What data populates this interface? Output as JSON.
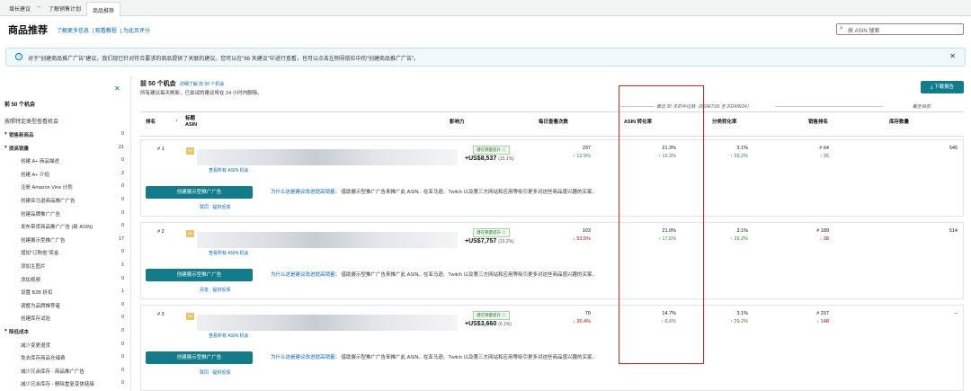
{
  "breadcrumbs": [
    "增长建议",
    "了解销售计划",
    "商品推荐"
  ],
  "page": {
    "title": "商品推荐",
    "links": [
      "了解更多信息",
      "观看教程",
      "为此页评分"
    ],
    "search_placeholder": "按 ASIN 搜索"
  },
  "banner": {
    "text": "对于\"创建商品推广广告\"建议，我们现已针对符合要求的商品提供了关联的建议。您可以在\"86 天建议\"中进行查看，也可以点击左侧导航栏中的\"创建商品推广广告\"。"
  },
  "sidebar": {
    "heading": "前 50 个机会",
    "subheading": "按照特定类型查看机会",
    "items": [
      {
        "label": "销售新商品",
        "count": "0",
        "cat": true
      },
      {
        "label": "提高销量",
        "count": "21",
        "cat": true
      },
      {
        "label": "创建 A+ 商品描述",
        "count": "0"
      },
      {
        "label": "创建 A+ 介绍",
        "count": "2"
      },
      {
        "label": "注册 Amazon Vine 计划",
        "count": "0"
      },
      {
        "label": "创建亚马逊商品推广广告",
        "count": "0"
      },
      {
        "label": "创建品牌推广广告",
        "count": "0"
      },
      {
        "label": "发布带货商品推广广告 (新 ASIN)",
        "count": "0"
      },
      {
        "label": "创建展示型推广广告",
        "count": "17"
      },
      {
        "label": "增加\"订购省\"资金",
        "count": "0"
      },
      {
        "label": "添加主图片",
        "count": "1"
      },
      {
        "label": "添加视频",
        "count": "0"
      },
      {
        "label": "设置 B2B 折扣",
        "count": "1"
      },
      {
        "label": "调整为品牌推荐者",
        "count": "0"
      },
      {
        "label": "创建库存试验",
        "count": "0"
      },
      {
        "label": "降低成本",
        "count": "0",
        "cat": true
      },
      {
        "label": "减少变更退货",
        "count": "0"
      },
      {
        "label": "免去库存商品仓储费",
        "count": "0"
      },
      {
        "label": "减少冗余库存 - 商品推广广告",
        "count": "0"
      },
      {
        "label": "减少冗余库存 - 删除重复变体链接",
        "count": "0"
      }
    ]
  },
  "main": {
    "heading": "前 50 个机会",
    "heading_link": "详细了解 前 50 个机会",
    "sub": "所有建议每天刷新，已尝试的建议将在 24 小时内删除。",
    "download": "下载报告",
    "group1": "最近 30 天的中位数（2024/7/26 至 2024/8/24）",
    "group2": "截至目前",
    "columns": [
      "排名",
      "标题\nASIN",
      "影响力",
      "每日查看次数",
      "ASIN 转化率",
      "分类转化率",
      "销售排名",
      "库存数量"
    ]
  },
  "rows": [
    {
      "rank": "# 1",
      "asin_link": "查看所有 ASIN 机会",
      "badge": "潜在销量提升 ⓘ",
      "impact": "+US$8,537",
      "impact_pct": "(15.1%)",
      "views": "237",
      "views_chg": "↑ 12.9%",
      "views_dir": "up",
      "conv": "21.3%",
      "conv_chg": "↑ 16.3%",
      "conv_dir": "up",
      "cat": "3.1%",
      "cat_chg": "↑ 29.2%",
      "cat_dir": "up",
      "sales_rank": "# 64",
      "sales_chg": "↑ 35",
      "sales_dir": "up",
      "stock": "545",
      "cta": "创建展示型推广广告",
      "why": "为什么这是建议改进提高销量：",
      "why_text": "借助展示型推广广告来推广此 ASIN。在亚马逊、Twitch 以及第三方网站和应用等吸引更多对这些商品感兴趣的买家。",
      "feedback": "赞同 · 提供反馈"
    },
    {
      "rank": "# 2",
      "asin_link": "查看所有 ASIN 机会",
      "badge": "潜在销量提升 ⓘ",
      "impact": "+US$7,757",
      "impact_pct": "(13.2%)",
      "views": "103",
      "views_chg": "↓ 53.5%",
      "views_dir": "down",
      "conv": "21.0%",
      "conv_chg": "↑ 17.5%",
      "conv_dir": "up",
      "cat": "3.1%",
      "cat_chg": "↑ 29.2%",
      "cat_dir": "up",
      "sales_rank": "# 189",
      "sales_chg": "↓ 28",
      "sales_dir": "down",
      "stock": "514",
      "cta": "创建展示型推广广告",
      "why": "为什么这是建议改进提高销量：",
      "why_text": "借助展示型推广广告来推广此 ASIN。在亚马逊、Twitch 以及第三方网站和应用等吸引更多对这些商品感兴趣的买家。",
      "feedback": "另享 · 提供反馈"
    },
    {
      "rank": "# 3",
      "asin_link": "查看所有 ASIN 机会",
      "badge": "潜在销量提升 ⓘ",
      "impact": "+US$3,660",
      "impact_pct": "(6.1%)",
      "views": "70",
      "views_chg": "↓ 36.4%",
      "views_dir": "down",
      "conv": "14.7%",
      "conv_chg": "↑ 6.6%",
      "conv_dir": "up",
      "cat": "3.1%",
      "cat_chg": "↑ 29.2%",
      "cat_dir": "up",
      "sales_rank": "# 237",
      "sales_chg": "↓ 148",
      "sales_dir": "down",
      "stock": "--",
      "cta": "创建展示型推广广告",
      "why": "为什么这是建议改进提高销量：",
      "why_text": "借助展示型推广广告来推广此 ASIN。在亚马逊、Twitch 以及第三方网站和应用等吸引更多对这些商品感兴趣的买家。",
      "feedback": "赞同 · 提供反馈"
    }
  ]
}
